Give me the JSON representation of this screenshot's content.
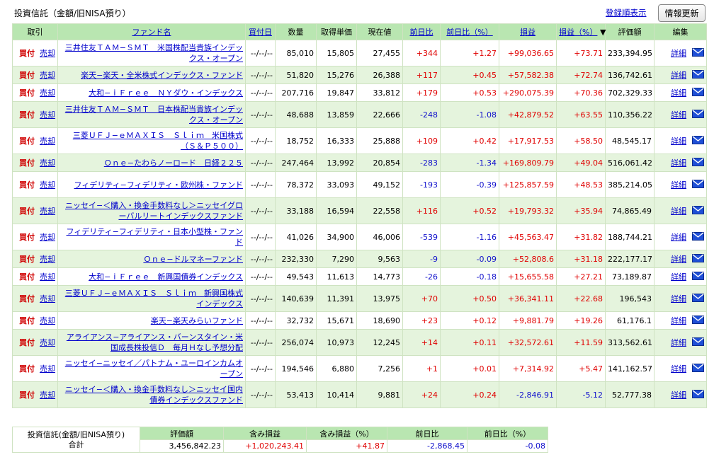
{
  "header": {
    "title": "投資信託（金額/旧NISA預り）",
    "sort_link": "登録順表示",
    "refresh_button": "情報更新"
  },
  "columns": {
    "trade": "取引",
    "fund_name": "ファンド名",
    "buy_date": "買付日",
    "quantity": "数量",
    "unit_cost": "取得単価",
    "current_price": "現在値",
    "day_change": "前日比",
    "day_change_pct": "前日比（%）",
    "gain": "損益",
    "gain_pct": "損益（%）",
    "sort_marker": "▼",
    "value": "評価額",
    "edit": "編集"
  },
  "labels": {
    "buy": "買付",
    "sell": "売却",
    "detail": "詳細"
  },
  "colors": {
    "header_bg": "#b9e6b1",
    "row_alt_bg": "#e5f4dd",
    "positive": "#e00000",
    "negative": "#1010cc",
    "link": "#0000cc"
  },
  "rows": [
    {
      "name": "三井住友ＴＡＭ−ＳＭＴ　米国株配当貴族インデックス・オープン",
      "date": "--/--/--",
      "qty": "85,010",
      "cost": "15,805",
      "price": "27,455",
      "chg": "+344",
      "chg_pct": "+1.27",
      "gain": "+99,036.65",
      "gain_pct": "+73.71",
      "value": "233,394.95"
    },
    {
      "name": "楽天−楽天・全米株式インデックス・ファンド",
      "date": "--/--/--",
      "qty": "51,820",
      "cost": "15,276",
      "price": "26,388",
      "chg": "+117",
      "chg_pct": "+0.45",
      "gain": "+57,582.38",
      "gain_pct": "+72.74",
      "value": "136,742.61"
    },
    {
      "name": "大和−ｉＦｒｅｅ　ＮＹダウ・インデックス",
      "date": "--/--/--",
      "qty": "207,716",
      "cost": "19,847",
      "price": "33,812",
      "chg": "+179",
      "chg_pct": "+0.53",
      "gain": "+290,075.39",
      "gain_pct": "+70.36",
      "value": "702,329.33"
    },
    {
      "name": "三井住友ＴＡＭ−ＳＭＴ　日本株配当貴族インデックス・オープン",
      "date": "--/--/--",
      "qty": "48,688",
      "cost": "13,859",
      "price": "22,666",
      "chg": "-248",
      "chg_pct": "-1.08",
      "gain": "+42,879.52",
      "gain_pct": "+63.55",
      "value": "110,356.22"
    },
    {
      "name": "三菱ＵＦＪ−ｅＭＡＸＩＳ　Ｓｌｉｍ　米国株式（Ｓ＆Ｐ５００）",
      "date": "--/--/--",
      "qty": "18,752",
      "cost": "16,333",
      "price": "25,888",
      "chg": "+109",
      "chg_pct": "+0.42",
      "gain": "+17,917.53",
      "gain_pct": "+58.50",
      "value": "48,545.17"
    },
    {
      "name": "Ｏｎｅ−たわらノーロード　日経２２５",
      "date": "--/--/--",
      "qty": "247,464",
      "cost": "13,992",
      "price": "20,854",
      "chg": "-283",
      "chg_pct": "-1.34",
      "gain": "+169,809.79",
      "gain_pct": "+49.04",
      "value": "516,061.42"
    },
    {
      "name": "フィデリティ−フィデリティ・欧州株・ファンド",
      "date": "--/--/--",
      "qty": "78,372",
      "cost": "33,093",
      "price": "49,152",
      "chg": "-193",
      "chg_pct": "-0.39",
      "gain": "+125,857.59",
      "gain_pct": "+48.53",
      "value": "385,214.05"
    },
    {
      "name": "ニッセイ−＜購入・換金手数料なし＞ニッセイグローバルリートインデックスファンド",
      "date": "--/--/--",
      "qty": "33,188",
      "cost": "16,594",
      "price": "22,558",
      "chg": "+116",
      "chg_pct": "+0.52",
      "gain": "+19,793.32",
      "gain_pct": "+35.94",
      "value": "74,865.49"
    },
    {
      "name": "フィデリティ−フィデリティ・日本小型株・ファンド",
      "date": "--/--/--",
      "qty": "41,026",
      "cost": "34,900",
      "price": "46,006",
      "chg": "-539",
      "chg_pct": "-1.16",
      "gain": "+45,563.47",
      "gain_pct": "+31.82",
      "value": "188,744.21"
    },
    {
      "name": "Ｏｎｅ−ドルマネーファンド",
      "date": "--/--/--",
      "qty": "232,330",
      "cost": "7,290",
      "price": "9,563",
      "chg": "-9",
      "chg_pct": "-0.09",
      "gain": "+52,808.6",
      "gain_pct": "+31.18",
      "value": "222,177.17"
    },
    {
      "name": "大和−ｉＦｒｅｅ　新興国債券インデックス",
      "date": "--/--/--",
      "qty": "49,543",
      "cost": "11,613",
      "price": "14,773",
      "chg": "-26",
      "chg_pct": "-0.18",
      "gain": "+15,655.58",
      "gain_pct": "+27.21",
      "value": "73,189.87"
    },
    {
      "name": "三菱ＵＦＪ−ｅＭＡＸＩＳ　Ｓｌｉｍ　新興国株式インデックス",
      "date": "--/--/--",
      "qty": "140,639",
      "cost": "11,391",
      "price": "13,975",
      "chg": "+70",
      "chg_pct": "+0.50",
      "gain": "+36,341.11",
      "gain_pct": "+22.68",
      "value": "196,543"
    },
    {
      "name": "楽天−楽天みらいファンド",
      "date": "--/--/--",
      "qty": "32,732",
      "cost": "15,671",
      "price": "18,690",
      "chg": "+23",
      "chg_pct": "+0.12",
      "gain": "+9,881.79",
      "gain_pct": "+19.26",
      "value": "61,176.1"
    },
    {
      "name": "アライアンス−アライアンス・バーンスタイン・米国成長株投信Ｄ　毎月Ｈなし予想分配",
      "date": "--/--/--",
      "qty": "256,074",
      "cost": "10,973",
      "price": "12,245",
      "chg": "+14",
      "chg_pct": "+0.11",
      "gain": "+32,572.61",
      "gain_pct": "+11.59",
      "value": "313,562.61"
    },
    {
      "name": "ニッセイ−ニッセイ／パトナム・ユーロインカムオープン",
      "date": "--/--/--",
      "qty": "194,546",
      "cost": "6,880",
      "price": "7,256",
      "chg": "+1",
      "chg_pct": "+0.01",
      "gain": "+7,314.92",
      "gain_pct": "+5.47",
      "value": "141,162.57"
    },
    {
      "name": "ニッセイ−＜購入・換金手数料なし＞ニッセイ国内債券インデックスファンド",
      "date": "--/--/--",
      "qty": "53,413",
      "cost": "10,414",
      "price": "9,881",
      "chg": "+24",
      "chg_pct": "+0.24",
      "gain": "-2,846.91",
      "gain_pct": "-5.12",
      "value": "52,777.38"
    }
  ],
  "summary": {
    "label_line1": "投資信託(金額/旧NISA預り)",
    "label_line2": "合計",
    "headers": [
      "評価額",
      "含み損益",
      "含み損益（%）",
      "前日比",
      "前日比（%）"
    ],
    "values": [
      "3,456,842.23",
      "+1,020,243.41",
      "+41.87",
      "-2,868.45",
      "-0.08"
    ]
  }
}
